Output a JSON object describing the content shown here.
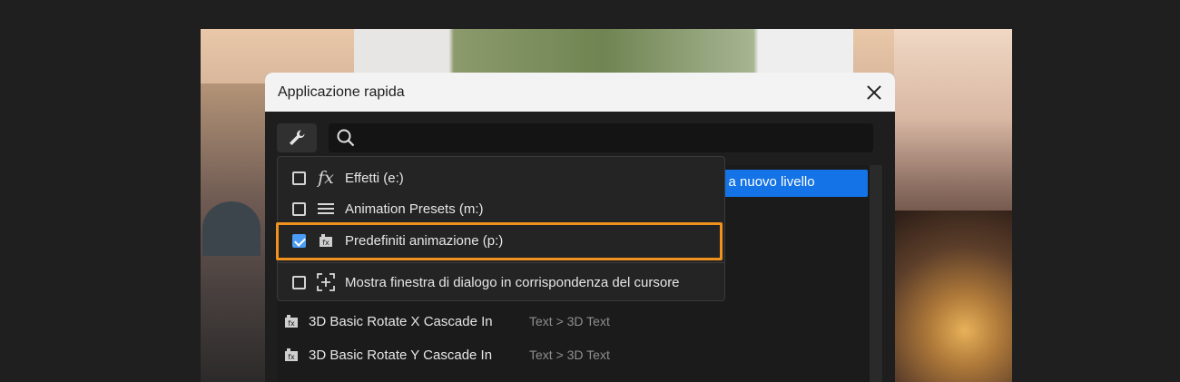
{
  "dialog": {
    "title": "Applicazione rapida"
  },
  "search": {
    "placeholder": ""
  },
  "filter_menu": {
    "items": [
      {
        "label": "Effetti (e:)",
        "checked": false,
        "icon": "fx-icon"
      },
      {
        "label": "Animation Presets (m:)",
        "checked": false,
        "icon": "list-lines-icon"
      },
      {
        "label": "Predefiniti animazione (p:)",
        "checked": true,
        "icon": "preset-icon"
      },
      {
        "label": "Mostra finestra di dialogo in corrispondenza del cursore",
        "checked": false,
        "icon": "cursor-dialog-icon"
      }
    ]
  },
  "results": {
    "highlighted_partial": "a a nuovo livello",
    "rows": [
      {
        "title": "3D Basic Rotate X Cascade In",
        "path": "Text > 3D Text"
      },
      {
        "title": "3D Basic Rotate Y Cascade In",
        "path": "Text > 3D Text"
      }
    ]
  },
  "colors": {
    "accent": "#1473e6",
    "highlight_outline": "#f0921d",
    "checkbox_checked": "#4b9cf5"
  }
}
